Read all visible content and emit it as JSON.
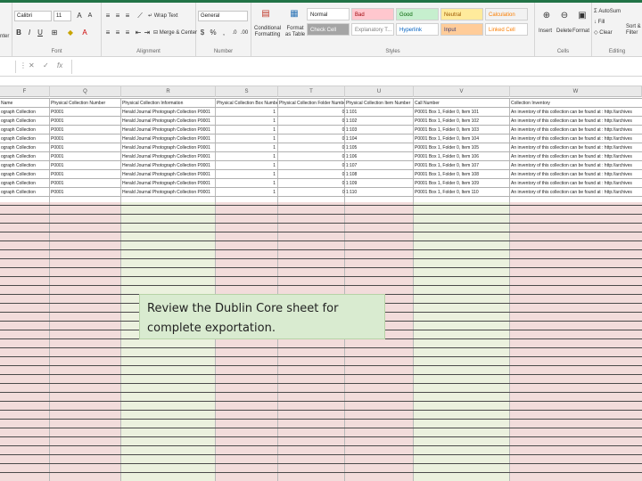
{
  "ribbon": {
    "font": {
      "name": "Calibri",
      "size": "11",
      "bold": "B",
      "italic": "I",
      "underline": "U",
      "group_label": "Font"
    },
    "alignment": {
      "wrap_text": "Wrap Text",
      "merge_center": "Merge & Center",
      "group_label": "Alignment"
    },
    "number": {
      "format": "General",
      "currency": "$",
      "percent": "%",
      "comma": ",",
      "group_label": "Number"
    },
    "styles": {
      "conditional": "Conditional Formatting",
      "format_as": "Format as Table",
      "cells": [
        {
          "label": "Normal",
          "bg": "#ffffff",
          "fg": "#222222"
        },
        {
          "label": "Bad",
          "bg": "#ffc7ce",
          "fg": "#9c0006"
        },
        {
          "label": "Good",
          "bg": "#c6efce",
          "fg": "#006100"
        },
        {
          "label": "Neutral",
          "bg": "#ffeb9c",
          "fg": "#9c5700"
        },
        {
          "label": "Calculation",
          "bg": "#f2f2f2",
          "fg": "#fa7d00"
        },
        {
          "label": "Check Cell",
          "bg": "#a5a5a5",
          "fg": "#ffffff"
        },
        {
          "label": "Explanatory T...",
          "bg": "#ffffff",
          "fg": "#7f7f7f"
        },
        {
          "label": "Hyperlink",
          "bg": "#ffffff",
          "fg": "#0563c1"
        },
        {
          "label": "Input",
          "bg": "#ffcc99",
          "fg": "#3f3f76"
        },
        {
          "label": "Linked Cell",
          "bg": "#ffffff",
          "fg": "#fa7d00"
        }
      ],
      "group_label": "Styles"
    },
    "cells_group": {
      "insert": "Insert",
      "delete": "Delete",
      "format": "Format",
      "group_label": "Cells"
    },
    "editing": {
      "autosum": "AutoSum",
      "fill": "Fill",
      "clear": "Clear",
      "sort": "Sort & Filter",
      "group_label": "Editing"
    },
    "clipboard": {
      "group_label": "nter"
    }
  },
  "formula_bar": {
    "cancel": "✕",
    "enter": "✓",
    "fx": "fx",
    "value": ""
  },
  "columns": [
    "F",
    "Q",
    "R",
    "S",
    "T",
    "U",
    "V",
    "W"
  ],
  "headers": [
    "Name",
    "Physical Collection Number",
    "Physical Collection Information",
    "Physical Collection Box Number",
    "Physical Collection Folder Number",
    "Physical Collection Item Number",
    "Call Number",
    "Collection Inventory"
  ],
  "rows": [
    [
      "ograph Collection",
      "P0001",
      "Herald Journal Photograph Collection P0001",
      "1",
      "",
      "0 1:101",
      "P0001 Box 1, Folder 0, Item 101",
      "An inventory of this collection can be found at : http://archives"
    ],
    [
      "ograph Collection",
      "P0001",
      "Herald Journal Photograph Collection P0001",
      "1",
      "",
      "0 1:102",
      "P0001 Box 1, Folder 0, Item 102",
      "An inventory of this collection can be found at : http://archives"
    ],
    [
      "ograph Collection",
      "P0001",
      "Herald Journal Photograph Collection P0001",
      "1",
      "",
      "0 1:103",
      "P0001 Box 1, Folder 0, Item 103",
      "An inventory of this collection can be found at : http://archives"
    ],
    [
      "ograph Collection",
      "P0001",
      "Herald Journal Photograph Collection P0001",
      "1",
      "",
      "0 1:104",
      "P0001 Box 1, Folder 0, Item 104",
      "An inventory of this collection can be found at : http://archives"
    ],
    [
      "ograph Collection",
      "P0001",
      "Herald Journal Photograph Collection P0001",
      "1",
      "",
      "0 1:105",
      "P0001 Box 1, Folder 0, Item 105",
      "An inventory of this collection can be found at : http://archives"
    ],
    [
      "ograph Collection",
      "P0001",
      "Herald Journal Photograph Collection P0001",
      "1",
      "",
      "0 1:106",
      "P0001 Box 1, Folder 0, Item 106",
      "An inventory of this collection can be found at : http://archives"
    ],
    [
      "ograph Collection",
      "P0001",
      "Herald Journal Photograph Collection P0001",
      "1",
      "",
      "0 1:107",
      "P0001 Box 1, Folder 0, Item 107",
      "An inventory of this collection can be found at : http://archives"
    ],
    [
      "ograph Collection",
      "P0001",
      "Herald Journal Photograph Collection P0001",
      "1",
      "",
      "0 1:108",
      "P0001 Box 1, Folder 0, Item 108",
      "An inventory of this collection can be found at : http://archives"
    ],
    [
      "ograph Collection",
      "P0001",
      "Herald Journal Photograph Collection P0001",
      "1",
      "",
      "0 1:109",
      "P0001 Box 1, Folder 0, Item 109",
      "An inventory of this collection can be found at : http://archives"
    ],
    [
      "ograph Collection",
      "P0001",
      "Herald Journal Photograph Collection P0001",
      "1",
      "",
      "0 1:110",
      "P0001 Box 1, Folder 0, Item 110",
      "An inventory of this collection can be found at : http://archives"
    ]
  ],
  "column_fills": [
    "#f2dcdb",
    "#f2dcdb",
    "#ebf1de",
    "#f2dcdb",
    "#f2dcdb",
    "#f2dcdb",
    "#ebf1de",
    "#f2dcdb"
  ],
  "note": {
    "line1": "Review the Dublin Core sheet for",
    "line2": "complete exportation."
  }
}
